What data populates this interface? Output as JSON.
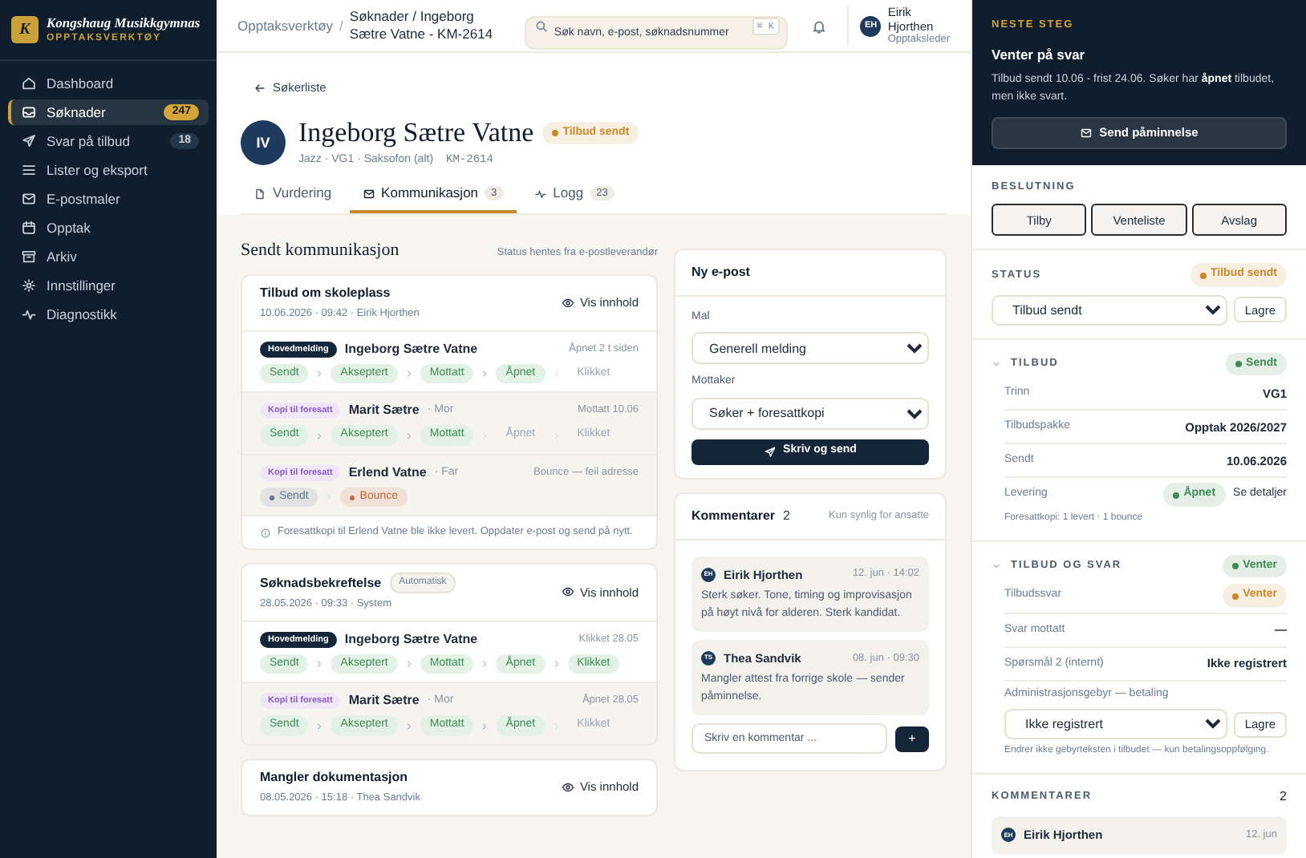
{
  "sidebar": {
    "logo_letter": "K",
    "brand": "Kongshaug Musikkgymnas",
    "subtitle": "OPPTAKSVERKTØY",
    "items": [
      {
        "label": "Dashboard",
        "selected": false
      },
      {
        "label": "Søknader",
        "badge": "247",
        "selected": true
      },
      {
        "label": "Svar på tilbud",
        "badge": "18",
        "selected": false
      },
      {
        "label": "Lister og eksport",
        "selected": false
      },
      {
        "label": "E-postmaler",
        "selected": false
      },
      {
        "label": "Opptak",
        "selected": false
      },
      {
        "label": "Arkiv",
        "selected": false
      },
      {
        "label": "Innstillinger",
        "selected": false
      },
      {
        "label": "Diagnostikk",
        "selected": false
      }
    ]
  },
  "topbar": {
    "breadcrumb_root": "Opptaksverktøy",
    "separator": "/",
    "breadcrumb_current": "Søknader / Ingeborg Sætre Vatne - KM-2614",
    "search": {
      "placeholder": "Søk navn, e-post, søknadsnummer",
      "shortcut": "⌘ K"
    },
    "user": {
      "initials": "EH",
      "name": "Eirik Hjorthen",
      "role": "Opptaksleder"
    }
  },
  "applicant": {
    "back": "Søkerliste",
    "initials": "IV",
    "name": "Ingeborg Sætre Vatne",
    "status": {
      "label": "Tilbud sendt",
      "color": "#c98a2b"
    },
    "meta": "Jazz · VG1 · Saksofon (alt)",
    "id": "KM-2614"
  },
  "tabs": [
    {
      "label": "Vurdering",
      "selected": false
    },
    {
      "label": "Kommunikasjon",
      "count": "3",
      "selected": true
    },
    {
      "label": "Logg",
      "count": "23",
      "selected": false
    }
  ],
  "communication": {
    "title": "Sendt kommunikasjon",
    "note": "Status hentes fra e-postleverandør",
    "messages": [
      {
        "title": "Tilbud om skoleplass",
        "meta": "10.06.2026 · 09:42 · Eirik Hjorthen",
        "view": "Vis innhold",
        "recipients": [
          {
            "kind": "main",
            "role": "Hovedmelding",
            "name": "Ingeborg Sætre Vatne",
            "status": "Åpnet 2 t siden",
            "steps": [
              {
                "label": "Sendt",
                "done": true
              },
              {
                "label": "Akseptert",
                "done": true
              },
              {
                "label": "Mottatt",
                "done": true
              },
              {
                "label": "Åpnet",
                "done": true
              },
              {
                "label": "Klikket",
                "done": false
              }
            ]
          },
          {
            "kind": "copy",
            "role": "Kopi til foresatt",
            "name": "Marit Sætre",
            "relation": "· Mor",
            "status": "Mottatt 10.06",
            "steps": [
              {
                "label": "Sendt",
                "done": true
              },
              {
                "label": "Akseptert",
                "done": true
              },
              {
                "label": "Mottatt",
                "done": true
              },
              {
                "label": "Åpnet",
                "done": false
              },
              {
                "label": "Klikket",
                "done": false
              }
            ]
          },
          {
            "kind": "copy",
            "role": "Kopi til foresatt",
            "name": "Erlend Vatne",
            "relation": "· Far",
            "status": "Bounce — feil adresse",
            "steps": [
              {
                "label": "Sendt",
                "color": "#64748b"
              },
              {
                "label": "Bounce",
                "color": "#c2683a"
              }
            ]
          }
        ],
        "warning": "Foresattkopi til Erlend Vatne ble ikke levert. Oppdater e-post og send på nytt."
      },
      {
        "title": "Søknadsbekreftelse",
        "tag": "Automatisk",
        "meta": "28.05.2026 · 09:33 · System",
        "view": "Vis innhold",
        "recipients": [
          {
            "kind": "main",
            "role": "Hovedmelding",
            "name": "Ingeborg Sætre Vatne",
            "status": "Klikket 28.05",
            "steps": [
              {
                "label": "Sendt",
                "done": true
              },
              {
                "label": "Akseptert",
                "done": true
              },
              {
                "label": "Mottatt",
                "done": true
              },
              {
                "label": "Åpnet",
                "done": true
              },
              {
                "label": "Klikket",
                "done": true
              }
            ]
          },
          {
            "kind": "copy",
            "role": "Kopi til foresatt",
            "name": "Marit Sætre",
            "relation": "· Mor",
            "status": "Åpnet 28.05",
            "steps": [
              {
                "label": "Sendt",
                "done": true
              },
              {
                "label": "Akseptert",
                "done": true
              },
              {
                "label": "Mottatt",
                "done": true
              },
              {
                "label": "Åpnet",
                "done": true
              },
              {
                "label": "Klikket",
                "done": false
              }
            ]
          }
        ]
      },
      {
        "title": "Mangler dokumentasjon",
        "meta": "08.05.2026 · 15:18 · Thea Sandvik",
        "view": "Vis innhold"
      }
    ]
  },
  "new_email": {
    "title": "Ny e-post",
    "fields": [
      {
        "label": "Mal",
        "value": "Generell melding"
      },
      {
        "label": "Mottaker",
        "value": "Søker + foresattkopi"
      }
    ],
    "button": "Skriv og send"
  },
  "comments": {
    "title": "Kommentarer",
    "count": "2",
    "note": "Kun synlig for ansatte",
    "items": [
      {
        "initials": "EH",
        "author": "Eirik Hjorthen",
        "time": "12. jun · 14:02",
        "text": "Sterk søker. Tone, timing og improvisasjon på høyt nivå for alderen. Sterk kandidat."
      },
      {
        "initials": "TS",
        "author": "Thea Sandvik",
        "time": "08. jun · 09:30",
        "text": "Mangler attest fra forrige skole — sender påminnelse."
      }
    ],
    "placeholder": "Skriv en kommentar ...",
    "add": "+"
  },
  "next_step": {
    "label": "NESTE STEG",
    "title": "Venter på svar",
    "text": "Tilbud sendt 10.06 - frist 24.06. Søker har **åpnet** tilbudet, men ikke svart.",
    "button": "Send påminnelse"
  },
  "decision": {
    "label": "BESLUTNING",
    "buttons": [
      "Tilby",
      "Venteliste",
      "Avslag"
    ]
  },
  "status": {
    "label": "STATUS",
    "badge": {
      "label": "Tilbud sendt",
      "color": "#c98a2b"
    },
    "value": "Tilbud sendt",
    "save": "Lagre"
  },
  "sections": [
    {
      "title": "TILBUD",
      "expanded": true,
      "badge": {
        "label": "Sendt",
        "color": "#3f8a55"
      },
      "rows": [
        {
          "kind": "text",
          "label": "Trinn",
          "value": "VG1"
        },
        {
          "kind": "text",
          "label": "Tilbudspakke",
          "value": "Opptak 2026/2027"
        },
        {
          "kind": "text",
          "label": "Sendt",
          "value": "10.06.2026"
        },
        {
          "kind": "badge_link",
          "label": "Levering",
          "badge": {
            "label": "Åpnet",
            "color": "#3f8a55"
          },
          "link": "Se detaljer",
          "hint": "Foresattkopi: 1 levert · 1 bounce"
        }
      ]
    },
    {
      "title": "TILBUD OG SVAR",
      "expanded": true,
      "badge": {
        "label": "Venter",
        "color": "#3f8a55"
      },
      "rows": [
        {
          "kind": "badge",
          "label": "Tilbudssvar",
          "badge": {
            "label": "Venter",
            "color": "#c98a2b"
          }
        },
        {
          "kind": "text",
          "label": "Svar mottatt",
          "value": "—"
        },
        {
          "kind": "text",
          "label": "Spørsmål 2 (internt)",
          "value": "Ikke registrert"
        },
        {
          "kind": "select",
          "label": "Administrasjonsgebyr — betaling",
          "value": "Ikke registrert",
          "save": "Lagre",
          "hint": "Endrer ikke gebyrteksten i tilbudet — kun betalingsoppfølging."
        }
      ]
    }
  ],
  "side_comments": {
    "label": "KOMMENTARER",
    "count": "2",
    "items": [
      {
        "initials": "EH",
        "author": "Eirik Hjorthen",
        "time": "12. jun"
      }
    ]
  }
}
